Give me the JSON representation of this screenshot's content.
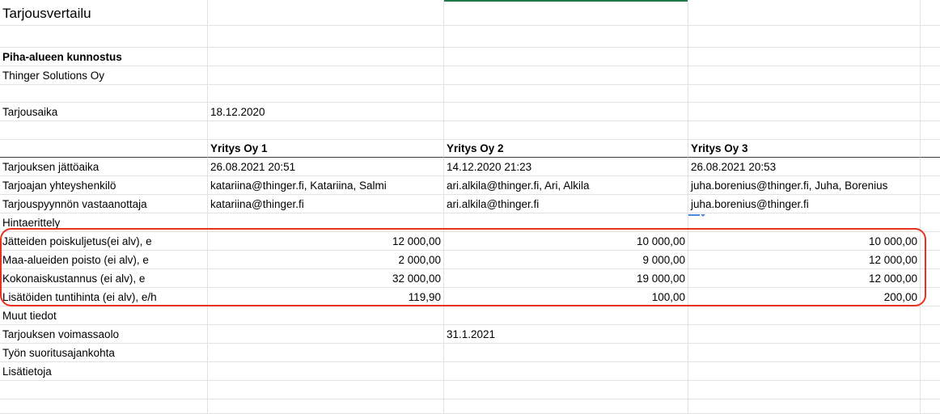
{
  "sheet": {
    "title": "Tarjousvertailu",
    "project": "Piha-alueen kunnostus",
    "company": "Thinger Solutions Oy",
    "offer_time_label": "Tarjousaika",
    "offer_time_value": "18.12.2020",
    "companies": [
      "Yritys Oy 1",
      "Yritys Oy 2",
      "Yritys Oy 3"
    ],
    "info_rows": [
      {
        "label": "Tarjouksen jättöaika",
        "values": [
          "26.08.2021 20:51",
          "14.12.2020 21:23",
          "26.08.2021 20:53"
        ]
      },
      {
        "label": "Tarjoajan yhteyshenkilö",
        "values": [
          "katariina@thinger.fi, Katariina, Salmi",
          "ari.alkila@thinger.fi, Ari, Alkila",
          "juha.borenius@thinger.fi, Juha, Borenius"
        ]
      },
      {
        "label": "Tarjouspyynnön vastaanottaja",
        "values": [
          "katariina@thinger.fi",
          "ari.alkila@thinger.fi",
          "juha.borenius@thinger.fi"
        ]
      }
    ],
    "pricing_label": "Hintaerittely",
    "price_rows": [
      {
        "label": "Jätteiden poiskuljetus(ei alv), e",
        "values": [
          "12 000,00",
          "10 000,00",
          "10 000,00"
        ]
      },
      {
        "label": "Maa-alueiden poisto (ei alv), e",
        "values": [
          "2 000,00",
          "9 000,00",
          "12 000,00"
        ]
      },
      {
        "label": "Kokonaiskustannus (ei alv), e",
        "values": [
          "32 000,00",
          "19 000,00",
          "12 000,00"
        ]
      },
      {
        "label": "Lisätöiden tuntihinta (ei alv), e/h",
        "values": [
          "119,90",
          "100,00",
          "200,00"
        ]
      }
    ],
    "other_label": "Muut tiedot",
    "validity_label": "Tarjouksen voimassaolo",
    "validity_value": "31.1.2021",
    "work_time_label": "Työn suoritusajankohta",
    "extra_label": "Lisätietoja"
  },
  "colors": {
    "highlight": "#e7331e",
    "active_column": "#1e7b4a",
    "dropdown": "#4a86e8",
    "gridline": "#e2e2e2"
  }
}
